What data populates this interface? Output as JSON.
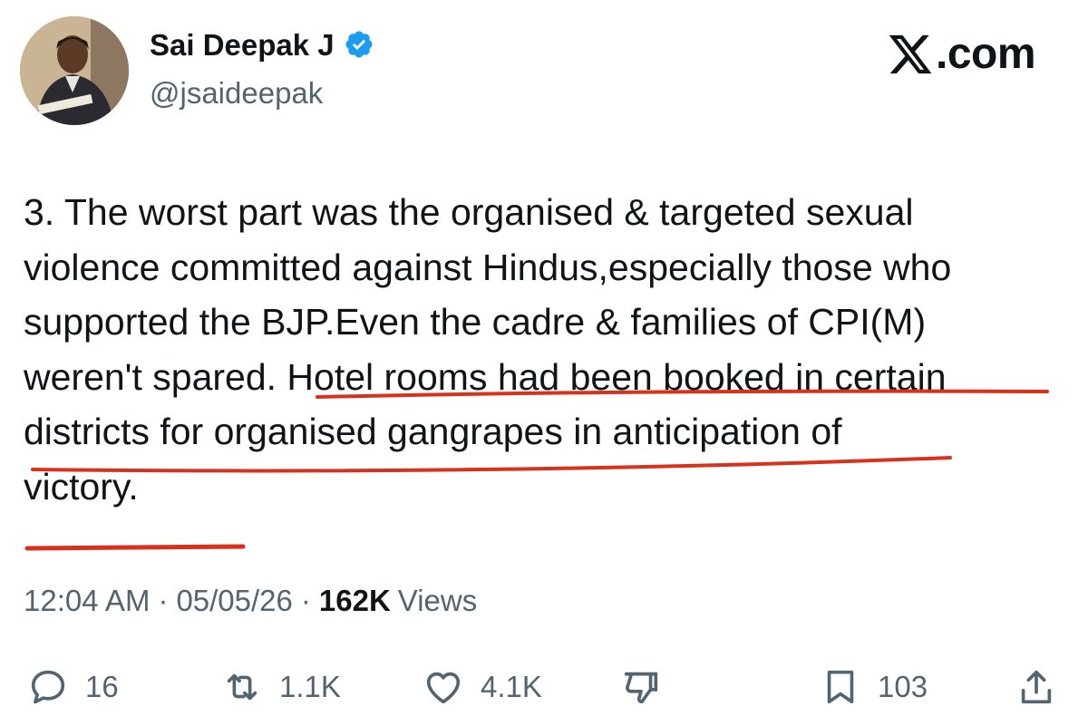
{
  "author": {
    "name": "Sai Deepak J",
    "handle": "@jsaideepak"
  },
  "brand": {
    "text": ".com"
  },
  "tweet": {
    "lines": [
      "3. The worst part was the organised & targeted sexual",
      "violence committed against Hindus,especially those who",
      "supported the BJP.Even the cadre & families of CPI(M)",
      "weren't spared. Hotel rooms had been booked in certain",
      "districts for organised gangrapes in anticipation of",
      "victory."
    ]
  },
  "meta": {
    "time": "12:04 AM",
    "separator": "·",
    "date": "05/05/26",
    "views_count": "162K",
    "views_label": "Views"
  },
  "actions": {
    "replies": "16",
    "reposts": "1.1K",
    "likes": "4.1K",
    "bookmarks": "103"
  },
  "colors": {
    "text": "#0f1419",
    "secondary": "#536471",
    "verified": "#1d9bf0",
    "annotation": "#d8321c"
  }
}
